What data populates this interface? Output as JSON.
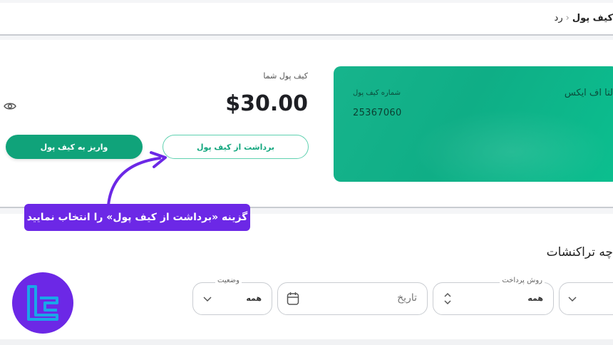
{
  "breadcrumb": {
    "prev": "رد",
    "current": "کیف پول"
  },
  "card": {
    "brand": "لتا اف ایکس",
    "number_label": "شماره کیف پول",
    "number": "25367060"
  },
  "wallet": {
    "title": "کیف پول شما",
    "balance": "$30.00"
  },
  "actions": {
    "withdraw": "برداشت از کیف پول",
    "deposit": "واریز به کیف پول"
  },
  "callout": {
    "text": "گزینه «برداشت از کیف پول» را انتخاب نمایید"
  },
  "transactions": {
    "title": "چه تراکنشات",
    "filters": {
      "payment_method": {
        "label": "روش پرداخت",
        "value": "همه"
      },
      "date": {
        "placeholder": "تاریخ"
      },
      "status": {
        "label": "وضعیت",
        "value": "همه"
      }
    }
  },
  "colors": {
    "accent": "#10a37a",
    "callout": "#6c28e6",
    "card": "#17b48c"
  },
  "icons": [
    "eye-icon",
    "chevron-down-icon",
    "calendar-icon",
    "sort-icon",
    "arrow-icon",
    "brand-logo"
  ]
}
